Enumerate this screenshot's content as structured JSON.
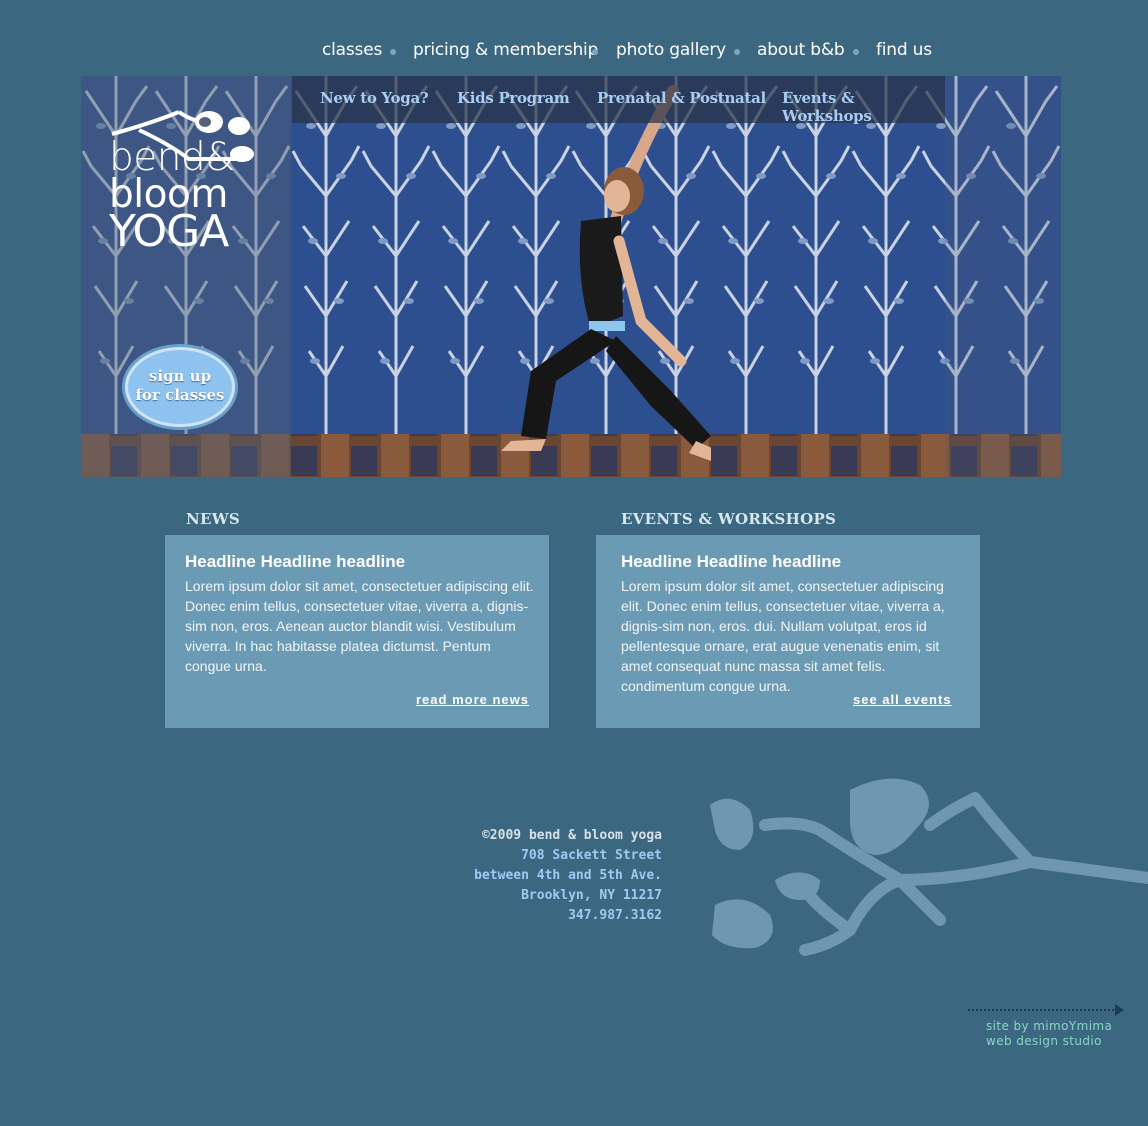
{
  "top_nav": {
    "classes": "classes",
    "pricing": "pricing & membership",
    "gallery": "photo gallery",
    "about": "about b&b",
    "find": "find us"
  },
  "sub_nav": {
    "new": "New to Yoga?",
    "kids": "Kids Program",
    "prenatal": "Prenatal & Postnatal",
    "events": "Events & Workshops"
  },
  "logo": {
    "line1": "bend&",
    "line2": "bloom",
    "line3": "YOGA"
  },
  "signup": {
    "line1": "sign up",
    "line2": "for classes"
  },
  "news": {
    "section_title": "NEWS",
    "headline": "Headline Headline headline",
    "body": "Lorem ipsum dolor sit amet, consectetuer adipiscing elit. Donec enim tellus, consectetuer vitae, viverra a, dignis-sim non, eros. Aenean auctor blandit wisi. Vestibulum viverra. In hac habitasse platea dictumst. Pentum congue urna.",
    "link": "read more news"
  },
  "events": {
    "section_title": "EVENTS & WORKSHOPS",
    "headline": "Headline Headline headline",
    "body": "Lorem ipsum dolor sit amet, consectetuer adipiscing elit. Donec enim tellus, consectetuer vitae, viverra a, dignis-sim non, eros. dui. Nullam volutpat, eros id pellentesque ornare, erat augue venenatis enim, sit amet consequat nunc massa sit amet felis. condimentum congue urna.",
    "link": "see all events"
  },
  "footer": {
    "copyright": "©2009 bend & bloom yoga",
    "street": "708 Sackett Street",
    "cross": "between 4th and 5th Ave.",
    "city": "Brooklyn, NY 11217",
    "phone": "347.987.3162"
  },
  "credit": {
    "line1": "site by mimoYmima",
    "line2": "web design studio"
  },
  "colors": {
    "background": "#3b6880",
    "card": "#6b9ab4",
    "sub_nav_text": "#a9cdf0",
    "address": "#9dcbf2",
    "credit": "#8ad6c4"
  },
  "icons": [
    "flower-branch-icon",
    "decorative-branch-icon",
    "arrow-right-icon"
  ]
}
